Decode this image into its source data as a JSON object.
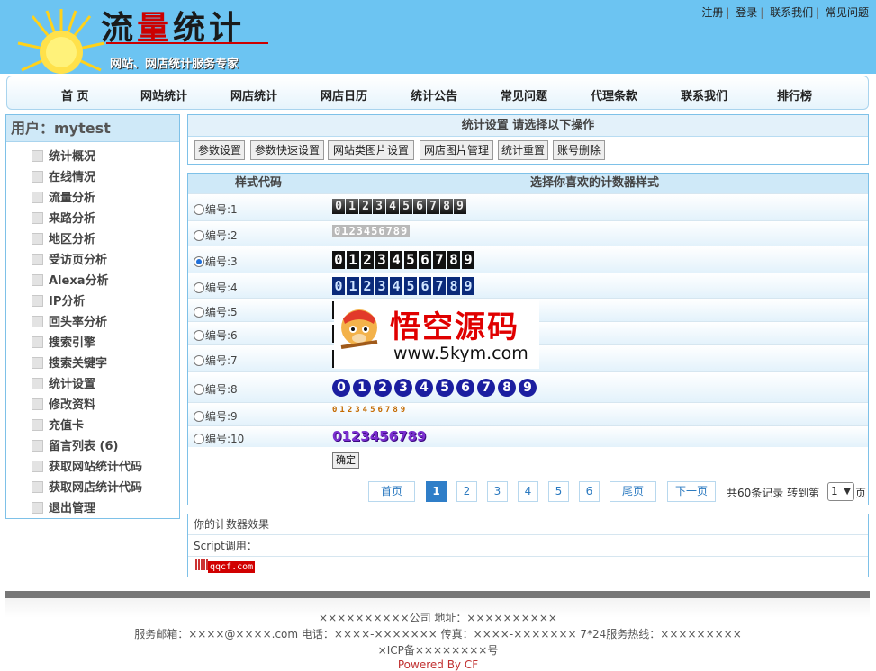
{
  "header": {
    "logo_title_1": "流",
    "logo_title_2": "量",
    "logo_title_3": "统计",
    "logo_subtitle": "网站、网店统计服务专家",
    "top_links": [
      "注册",
      "登录",
      "联系我们",
      "常见问题"
    ]
  },
  "nav": [
    "首 页",
    "网站统计",
    "网店统计",
    "网店日历",
    "统计公告",
    "常见问题",
    "代理条款",
    "联系我们",
    "排行榜"
  ],
  "sidebar": {
    "user_label": "用户：mytest",
    "items": [
      {
        "label": "统计概况",
        "icon": "chart-icon"
      },
      {
        "label": "在线情况",
        "icon": "document-icon"
      },
      {
        "label": "流量分析",
        "icon": "list-icon"
      },
      {
        "label": "来路分析",
        "icon": "window-icon"
      },
      {
        "label": "地区分析",
        "icon": "map-icon"
      },
      {
        "label": "受访页分析",
        "icon": "page-icon"
      },
      {
        "label": "Alexa分析",
        "icon": "globe-icon"
      },
      {
        "label": "IP分析",
        "icon": "network-icon"
      },
      {
        "label": "回头率分析",
        "icon": "return-icon"
      },
      {
        "label": "搜索引擎",
        "icon": "search-icon"
      },
      {
        "label": "搜索关键字",
        "icon": "keyword-icon"
      },
      {
        "label": "统计设置",
        "icon": "gear-icon"
      },
      {
        "label": "修改资料",
        "icon": "edit-icon"
      },
      {
        "label": "充值卡",
        "icon": "card-icon"
      },
      {
        "label": "留言列表 (6)",
        "icon": "message-icon"
      },
      {
        "label": "获取网站统计代码",
        "icon": "code-icon"
      },
      {
        "label": "获取网店统计代码",
        "icon": "code-icon"
      },
      {
        "label": "退出管理",
        "icon": "exit-icon"
      }
    ]
  },
  "settings": {
    "title": "统计设置 请选择以下操作",
    "buttons": [
      "参数设置",
      "参数快速设置",
      "网站类图片设置",
      "网店图片管理",
      "统计重置",
      "账号删除"
    ]
  },
  "counter_table": {
    "col_code": "样式代码",
    "col_style": "选择你喜欢的计数器样式",
    "rows": [
      "编号:1",
      "编号:2",
      "编号:3",
      "编号:4",
      "编号:5",
      "编号:6",
      "编号:7",
      "编号:8",
      "编号:9",
      "编号:10"
    ],
    "selected_row": 3,
    "sample_digits": "0123456789",
    "confirm_label": "确定"
  },
  "watermark": {
    "title": "悟空源码",
    "url": "www.5kym.com"
  },
  "pagination": {
    "first": "首页",
    "pages": [
      "1",
      "2",
      "3",
      "4",
      "5",
      "6"
    ],
    "current": "1",
    "last": "尾页",
    "next": "下一页",
    "total_text": "共60条记录",
    "goto_text": "转到第",
    "goto_value": "1",
    "page_suffix": "页"
  },
  "effect": {
    "label_effect": "你的计数器效果",
    "label_script": "Script调用：",
    "badge_text": "qqcf.com"
  },
  "footer": {
    "line1": "××××××××××公司 地址：××××××××××",
    "line2": "服务邮箱：××××@××××.com 电话：××××-××××××× 传真：××××-××××××× 7*24服务热线：×××××××××",
    "line3": "×ICP备××××××××号",
    "line4": "Powered By CF"
  },
  "colors": {
    "header_bg": "#6cc4f2",
    "panel_border": "#7ec1e8",
    "page_current": "#2f7ec8",
    "watermark_red": "#e00000"
  }
}
